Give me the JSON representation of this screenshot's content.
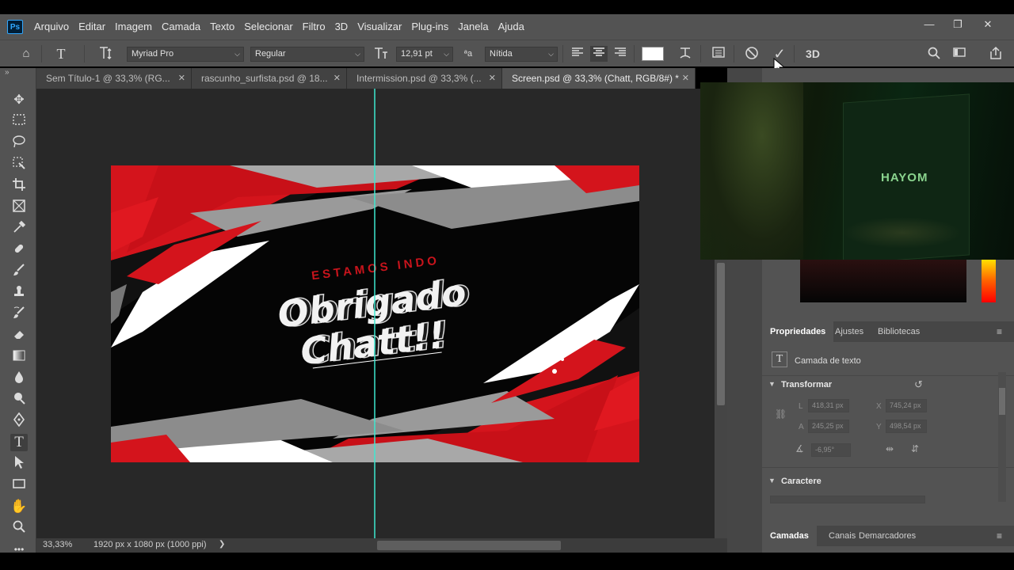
{
  "app": {
    "logo": "Ps",
    "menu": [
      "Arquivo",
      "Editar",
      "Imagem",
      "Camada",
      "Texto",
      "Selecionar",
      "Filtro",
      "3D",
      "Visualizar",
      "Plug-ins",
      "Janela",
      "Ajuda"
    ],
    "window_controls": {
      "minimize": "—",
      "restore": "❐",
      "close": "✕"
    }
  },
  "options_bar": {
    "font_family": "Myriad Pro",
    "font_style": "Regular",
    "font_size": "12,91 pt",
    "antialias_icon": "ªa",
    "antialias": "Nítida",
    "three_d": "3D"
  },
  "tabs": [
    {
      "label": "Sem Título-1 @ 33,3% (RG...",
      "close": "✕"
    },
    {
      "label": "rascunho_surfista.psd @ 18...",
      "close": "✕"
    },
    {
      "label": "Intermission.psd @ 33,3% (...",
      "close": "✕"
    },
    {
      "label": "Screen.psd @ 33,3% (Chatt, RGB/8#) *",
      "close": "✕"
    }
  ],
  "artwork": {
    "subtitle": "ESTAMOS INDO",
    "line1": "Obrigado",
    "line2": "Chatt!!"
  },
  "status": {
    "zoom": "33,33%",
    "doc_info": "1920 px x 1080 px (1000 ppi)",
    "arrow": "❯"
  },
  "webcam": {
    "brand": "HAYOM"
  },
  "properties": {
    "tabs": [
      "Propriedades",
      "Ajustes",
      "Bibliotecas"
    ],
    "layer_kind": "Camada de texto",
    "transform_title": "Transformar",
    "L_label": "L",
    "L": "418,31 px",
    "X_label": "X",
    "X": "745,24 px",
    "A_label": "A",
    "A": "245,25 px",
    "Y_label": "Y",
    "Y": "498,54 px",
    "angle": "-6,95°",
    "character_title": "Caractere"
  },
  "layers_panel": {
    "tabs": [
      "Camadas",
      "Canais",
      "Demarcadores"
    ]
  },
  "colors": {
    "ui_bg": "#535353",
    "canvas_bg": "#282828",
    "guide": "#3ee8d0",
    "art_red": "#d4141c",
    "accent_blue": "#31a8ff"
  }
}
